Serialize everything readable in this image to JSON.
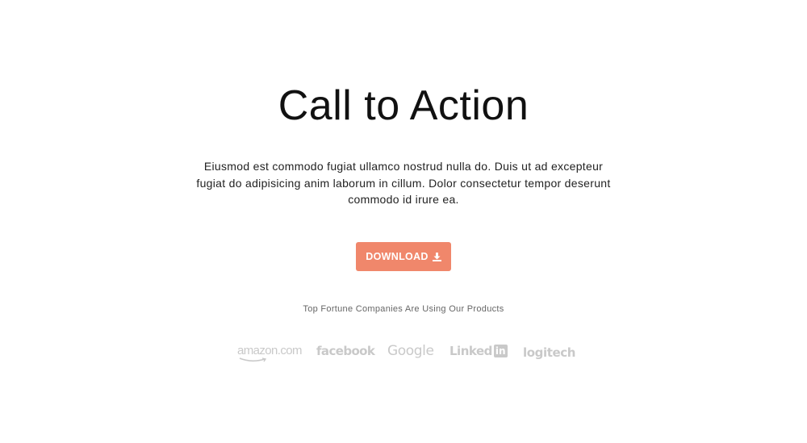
{
  "cta": {
    "title": "Call to Action",
    "description": "Eiusmod est commodo fugiat ullamco nostrud nulla do. Duis ut ad excepteur fugiat do adipisicing anim laborum in cillum. Dolor consectetur tempor deserunt commodo id irure ea.",
    "button_label": "DOWNLOAD",
    "button_icon": "download-icon",
    "tagline": "Top Fortune Companies Are Using Our Products"
  },
  "logos": {
    "amazon": "amazon.com",
    "facebook": "facebook",
    "google": "Google",
    "linkedin_text": "Linked",
    "linkedin_box": "in",
    "logitech": "logitech"
  },
  "colors": {
    "accent": "#f0876b",
    "logo_gray": "#c9c9c9",
    "title": "#111111"
  }
}
